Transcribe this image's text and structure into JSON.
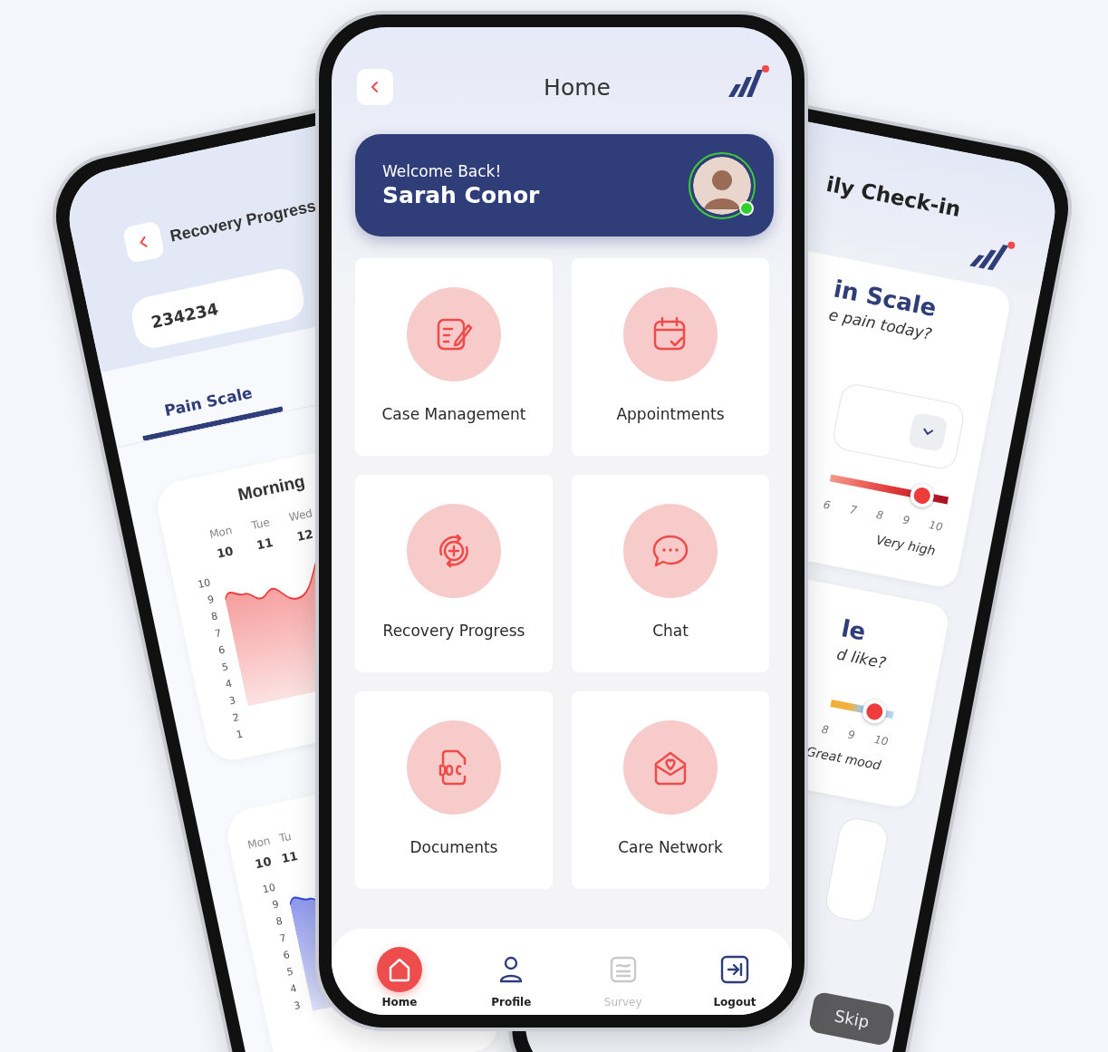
{
  "left_phone": {
    "title": "Recovery Progress",
    "field_value": "234234",
    "tabs": [
      {
        "label": "Pain Scale",
        "selected": true
      }
    ],
    "charts": [
      {
        "title": "Morning",
        "color": "#ee3b3b",
        "days": [
          {
            "day": "Mon",
            "date": "10"
          },
          {
            "day": "Tue",
            "date": "11"
          },
          {
            "day": "Wed",
            "date": "12"
          }
        ],
        "yticks": [
          "10",
          "9",
          "8",
          "7",
          "6",
          "5",
          "4",
          "3",
          "2",
          "1"
        ]
      },
      {
        "color": "#3346e0",
        "days": [
          {
            "day": "Mon",
            "date": "10"
          },
          {
            "day": "Tu",
            "date": "11"
          }
        ],
        "yticks": [
          "10",
          "9",
          "8",
          "7",
          "6",
          "5",
          "4",
          "3"
        ]
      }
    ]
  },
  "center_phone": {
    "title": "Home",
    "welcome": {
      "greeting": "Welcome Back!",
      "name": "Sarah Conor",
      "online": true
    },
    "tiles": [
      {
        "label": "Case Management",
        "kind": "edit"
      },
      {
        "label": "Appointments",
        "kind": "calendar"
      },
      {
        "label": "Recovery Progress",
        "kind": "recovery"
      },
      {
        "label": "Chat",
        "kind": "chat"
      },
      {
        "label": "Documents",
        "kind": "doc"
      },
      {
        "label": "Care Network",
        "kind": "mail"
      }
    ],
    "nav": [
      {
        "label": "Home",
        "kind": "home",
        "selected": true,
        "disabled": false
      },
      {
        "label": "Profile",
        "kind": "profile",
        "selected": false,
        "disabled": false
      },
      {
        "label": "Survey",
        "kind": "survey",
        "selected": false,
        "disabled": true
      },
      {
        "label": "Logout",
        "kind": "logout",
        "selected": false,
        "disabled": false
      }
    ]
  },
  "right_phone": {
    "title": "ily Check-in",
    "sections": [
      {
        "kind": "pain",
        "title": "in Scale",
        "question": "e pain today?",
        "scale": [
          "6",
          "7",
          "8",
          "9",
          "10"
        ],
        "level": 0.78,
        "end_label": "Very high"
      },
      {
        "kind": "mood",
        "title": "le",
        "question": "d like?",
        "scale": [
          "8",
          "9",
          "10"
        ],
        "level": 0.7,
        "end_label": "Great mood"
      }
    ],
    "skip_button": "Skip"
  }
}
